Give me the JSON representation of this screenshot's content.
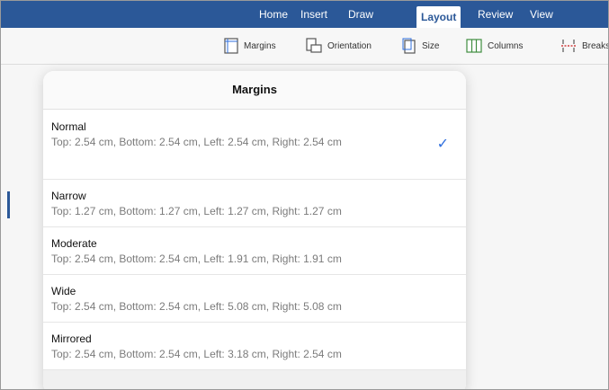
{
  "ribbon": {
    "tabs": [
      {
        "label": "Home"
      },
      {
        "label": "Insert"
      },
      {
        "label": "Draw"
      },
      {
        "label": "Layout"
      },
      {
        "label": "Review"
      },
      {
        "label": "View"
      }
    ],
    "active_tab": "Layout",
    "colors": {
      "ribbon": "#2b5898",
      "accent": "#2f6fde"
    }
  },
  "toolbar": {
    "margins_label": "Margins",
    "orientation_label": "Orientation",
    "size_label": "Size",
    "columns_label": "Columns",
    "breaks_label": "Breaks"
  },
  "popover": {
    "title": "Margins",
    "options": [
      {
        "name": "Normal",
        "detail": "Top: 2.54 cm, Bottom: 2.54 cm, Left: 2.54 cm, Right: 2.54 cm",
        "selected": true
      },
      {
        "name": "Narrow",
        "detail": "Top: 1.27 cm, Bottom: 1.27 cm, Left: 1.27 cm, Right: 1.27 cm",
        "selected": false
      },
      {
        "name": "Moderate",
        "detail": "Top: 2.54 cm, Bottom: 2.54 cm, Left: 1.91 cm, Right: 1.91 cm",
        "selected": false
      },
      {
        "name": "Wide",
        "detail": "Top: 2.54 cm, Bottom: 2.54 cm, Left: 5.08 cm, Right: 5.08 cm",
        "selected": false
      },
      {
        "name": "Mirrored",
        "detail": "Top: 2.54 cm, Bottom: 2.54 cm, Left: 3.18 cm, Right: 2.54 cm",
        "selected": false
      }
    ],
    "check_icon": "checkmark-icon"
  }
}
